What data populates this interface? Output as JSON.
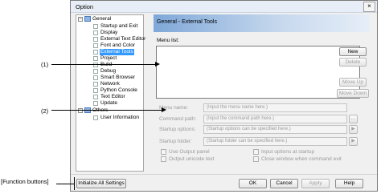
{
  "window": {
    "title": "Option",
    "close_label": "×"
  },
  "tree": {
    "items": [
      {
        "label": "General"
      },
      {
        "label": "Startup and Exit"
      },
      {
        "label": "Display"
      },
      {
        "label": "External Text Editor"
      },
      {
        "label": "Font and Color"
      },
      {
        "label": "External Tools"
      },
      {
        "label": "Project"
      },
      {
        "label": "Build"
      },
      {
        "label": "Debug"
      },
      {
        "label": "Smart Browser"
      },
      {
        "label": "Network"
      },
      {
        "label": "Python Console"
      },
      {
        "label": "Text Editor"
      },
      {
        "label": "Update"
      },
      {
        "label": "Others"
      },
      {
        "label": "User Information"
      }
    ],
    "expander_minus": "−"
  },
  "header": {
    "title": "General - External Tools"
  },
  "menu_list": {
    "label": "Menu list:",
    "buttons": {
      "new": "New",
      "delete": "Delete",
      "move_up": "Move Up",
      "move_down": "Move Down"
    }
  },
  "fields": {
    "menu_name": {
      "label": "Menu name:",
      "placeholder": "(Input the menu name here.)"
    },
    "command_path": {
      "label": "Command path:",
      "placeholder": "(Input the command path here.)",
      "browse": "..."
    },
    "startup_options": {
      "label": "Startup options:",
      "placeholder": "(Startup options can be specified here.)",
      "arrow": "▶"
    },
    "startup_folder": {
      "label": "Startup folder:",
      "placeholder": "(Startup folder can be specified here.)",
      "arrow": "▶"
    }
  },
  "checkboxes": {
    "use_output_panel": "Use Output panel",
    "output_unicode": "Output unicode text",
    "input_options": "Input options at startup",
    "close_window": "Close window when command exit"
  },
  "bottom": {
    "initialize": "Initialize All Settings",
    "ok": "OK",
    "cancel": "Cancel",
    "apply": "Apply",
    "help": "Help"
  },
  "annotations": {
    "one": "(1)",
    "two": "(2)",
    "function_buttons": "[Function buttons]"
  }
}
